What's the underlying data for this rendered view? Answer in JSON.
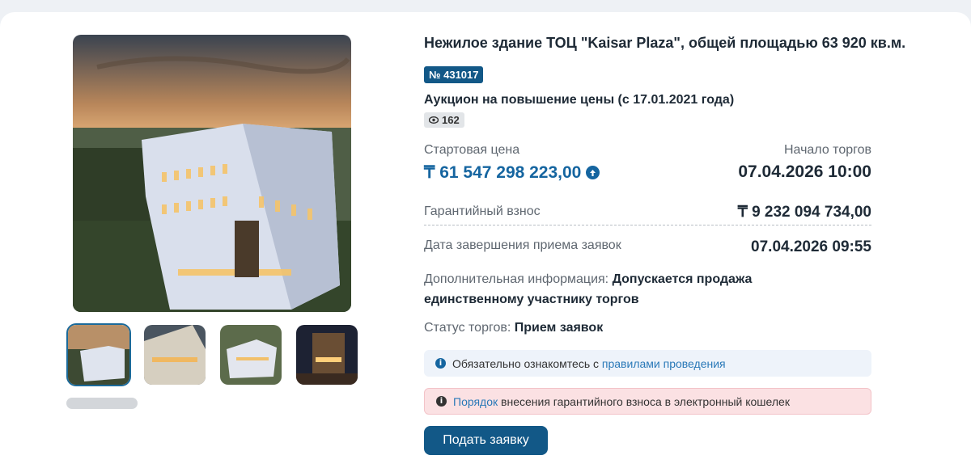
{
  "lot": {
    "title": "Нежилое здание ТОЦ \"Kaisar Plaza\", общей площадью 63 920 кв.м.",
    "number": "№ 431017",
    "auction_type": "Аукцион на повышение цены (с 17.01.2021 года)",
    "views": "162"
  },
  "pricing": {
    "start_label": "Стартовая цена",
    "start_value": "₸ 61 547 298 223,00",
    "begin_label": "Начало торгов",
    "begin_value": "07.04.2026 10:00",
    "guarantee_label": "Гарантийный взнос",
    "guarantee_value": "₸ 9 232 094 734,00",
    "end_label": "Дата завершения приема заявок",
    "end_value": "07.04.2026 09:55"
  },
  "extra": {
    "label": "Дополнительная информация:",
    "value": "Допускается продажа единственному участнику торгов"
  },
  "status": {
    "label": "Статус торгов:",
    "value": "Прием заявок"
  },
  "notices": {
    "info_prefix": "Обязательно ознакомтесь с",
    "info_link": "правилами проведения",
    "warn_link": "Порядок",
    "warn_text": "внесения гарантийного взноса в электронный кошелек"
  },
  "actions": {
    "apply_label": "Подать заявку"
  },
  "icons": {
    "views": "eye-icon",
    "price_up": "arrow-up-circle-icon",
    "info": "info-icon"
  },
  "colors": {
    "accent": "#125887",
    "price": "#1565a0",
    "warn_bg": "#fbe1e3",
    "info_bg": "#eef3fa"
  }
}
